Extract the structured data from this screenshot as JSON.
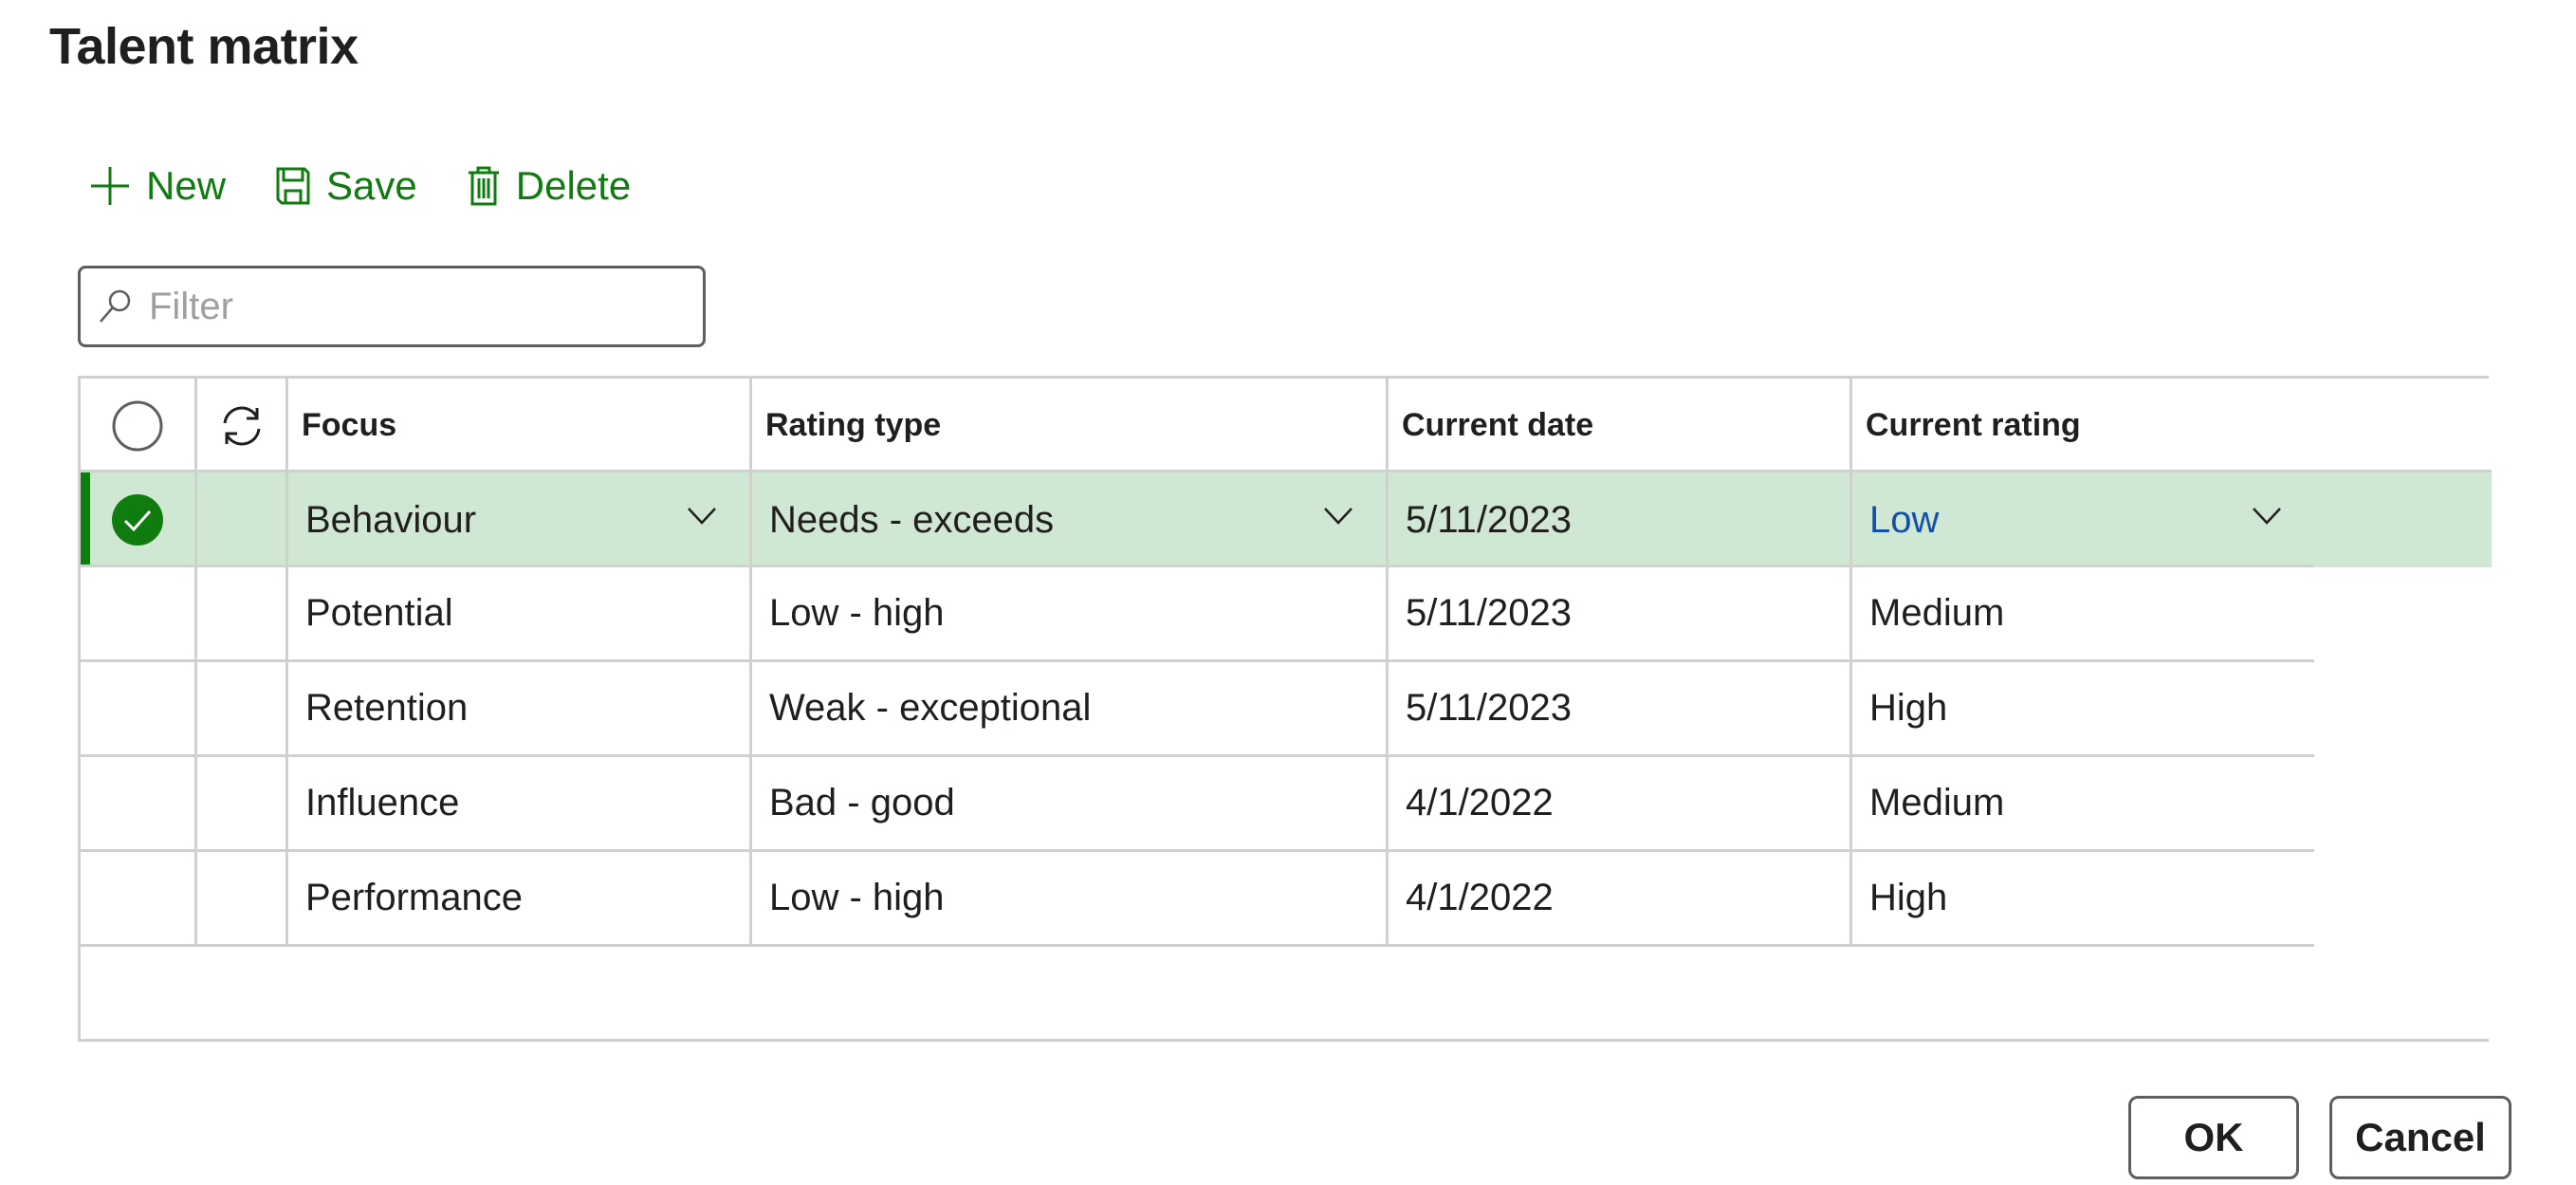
{
  "dialog": {
    "title": "Talent matrix"
  },
  "toolbar": {
    "new_label": "New",
    "save_label": "Save",
    "delete_label": "Delete",
    "accent_color": "#107c10"
  },
  "filter": {
    "placeholder": "Filter",
    "value": ""
  },
  "grid": {
    "columns": [
      "Focus",
      "Rating type",
      "Current date",
      "Current rating"
    ],
    "rows": [
      {
        "focus": "Behaviour",
        "rating_type": "Needs - exceeds",
        "current_date": "5/11/2023",
        "current_rating": "Low",
        "selected": true
      },
      {
        "focus": "Potential",
        "rating_type": "Low - high",
        "current_date": "5/11/2023",
        "current_rating": "Medium",
        "selected": false
      },
      {
        "focus": "Retention",
        "rating_type": "Weak - exceptional",
        "current_date": "5/11/2023",
        "current_rating": "High",
        "selected": false
      },
      {
        "focus": "Influence",
        "rating_type": "Bad - good",
        "current_date": "4/1/2022",
        "current_rating": "Medium",
        "selected": false
      },
      {
        "focus": "Performance",
        "rating_type": "Low - high",
        "current_date": "4/1/2022",
        "current_rating": "High",
        "selected": false
      }
    ],
    "selected_row_color": "#d0e7d4"
  },
  "footer": {
    "ok_label": "OK",
    "cancel_label": "Cancel"
  }
}
